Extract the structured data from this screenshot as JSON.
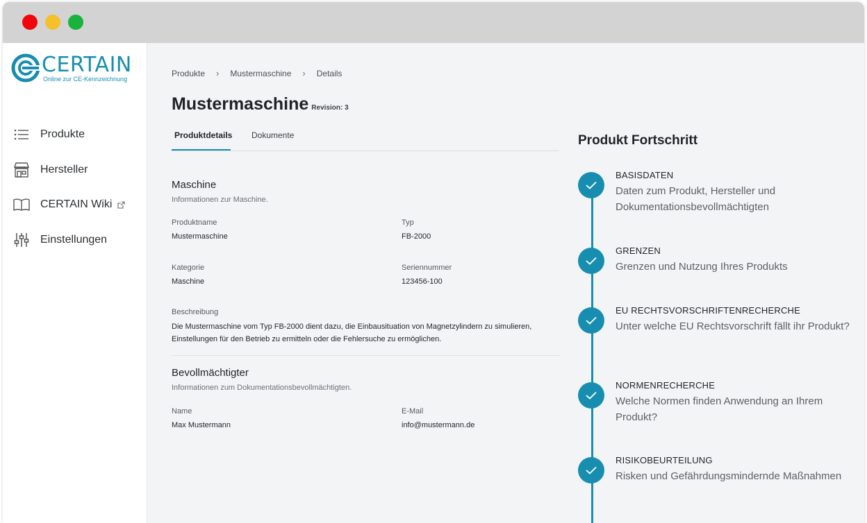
{
  "brand": {
    "name": "CERTAIN",
    "tagline": "Online zur CE-Kennzeichnung",
    "accent_color": "#178eb0"
  },
  "window_controls": [
    "close",
    "minimize",
    "maximize"
  ],
  "sidebar": {
    "items": [
      {
        "label": "Produkte",
        "icon": "list-icon"
      },
      {
        "label": "Hersteller",
        "icon": "store-icon"
      },
      {
        "label": "CERTAIN Wiki",
        "icon": "book-icon",
        "external": true
      },
      {
        "label": "Einstellungen",
        "icon": "sliders-icon"
      }
    ]
  },
  "breadcrumb": [
    "Produkte",
    "Mustermaschine",
    "Details"
  ],
  "page": {
    "title": "Mustermaschine",
    "revision": "Revision: 3"
  },
  "tabs": [
    {
      "label": "Produktdetails",
      "active": true
    },
    {
      "label": "Dokumente",
      "active": false
    }
  ],
  "machine": {
    "title": "Maschine",
    "subtitle": "Informationen zur Maschine.",
    "fields": {
      "product_name_label": "Produktname",
      "product_name": "Mustermaschine",
      "type_label": "Typ",
      "type": "FB-2000",
      "category_label": "Kategorie",
      "category": "Maschine",
      "serial_label": "Seriennummer",
      "serial": "123456-100",
      "description_label": "Beschreibung",
      "description": "Die Mustermaschine vom Typ FB-2000 dient dazu, die Einbausituation von Magnetzylindern zu simulieren, Einstellungen für den Betrieb zu ermitteln oder die Fehlersuche zu ermöglichen."
    }
  },
  "representative": {
    "title": "Bevollmächtigter",
    "subtitle": "Informationen zum Dokumentationsbevollmächtigten.",
    "name_label": "Name",
    "name": "Max Mustermann",
    "email_label": "E-Mail",
    "email": "info@mustermann.de"
  },
  "progress": {
    "title": "Produkt Fortschritt",
    "steps": [
      {
        "title": "BASISDATEN",
        "desc": "Daten zum Produkt, Hersteller und Dokumentationsbevollmächtigten",
        "done": true
      },
      {
        "title": "GRENZEN",
        "desc": "Grenzen und Nutzung Ihres Produkts",
        "done": true
      },
      {
        "title": "EU RECHTSVORSCHRIFTENRECHERCHE",
        "desc": "Unter welche EU Rechtsvorschrift fällt ihr Produkt?",
        "done": true
      },
      {
        "title": "NORMENRECHERCHE",
        "desc": "Welche Normen finden Anwendung an Ihrem Produkt?",
        "done": true
      },
      {
        "title": "RISIKOBEURTEILUNG",
        "desc": "Risken und Gefährdungsmindernde Maßnahmen",
        "done": true
      }
    ]
  }
}
